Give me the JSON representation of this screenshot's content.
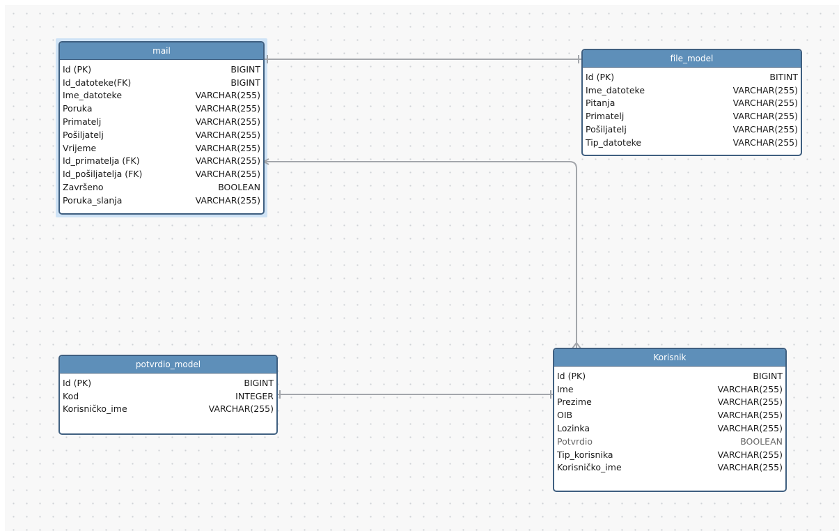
{
  "entities": {
    "mail": {
      "title": "mail",
      "fields": [
        {
          "name": "Id (PK)",
          "type": "BIGINT"
        },
        {
          "name": "Id_datoteke(FK)",
          "type": "BIGINT"
        },
        {
          "name": "Ime_datoteke",
          "type": "VARCHAR(255)"
        },
        {
          "name": "Poruka",
          "type": "VARCHAR(255)"
        },
        {
          "name": "Primatelj",
          "type": "VARCHAR(255)"
        },
        {
          "name": "Pošiljatelj",
          "type": "VARCHAR(255)"
        },
        {
          "name": "Vrijeme",
          "type": "VARCHAR(255)"
        },
        {
          "name": "Id_primatelja (FK)",
          "type": "VARCHAR(255)"
        },
        {
          "name": "Id_pošiljatelja (FK)",
          "type": "VARCHAR(255)"
        },
        {
          "name": "Završeno",
          "type": "BOOLEAN"
        },
        {
          "name": "Poruka_slanja",
          "type": "VARCHAR(255)"
        }
      ]
    },
    "file_model": {
      "title": "file_model",
      "fields": [
        {
          "name": "Id (PK)",
          "type": "BITINT"
        },
        {
          "name": "Ime_datoteke",
          "type": "VARCHAR(255)"
        },
        {
          "name": "Pitanja",
          "type": "VARCHAR(255)"
        },
        {
          "name": "Primatelj",
          "type": "VARCHAR(255)"
        },
        {
          "name": "Pošiljatelj",
          "type": "VARCHAR(255)"
        },
        {
          "name": "Tip_datoteke",
          "type": "VARCHAR(255)"
        }
      ]
    },
    "potvrdio_model": {
      "title": "potvrdio_model",
      "fields": [
        {
          "name": "Id (PK)",
          "type": "BIGINT"
        },
        {
          "name": "Kod",
          "type": "INTEGER"
        },
        {
          "name": "Korisničko_ime",
          "type": "VARCHAR(255)"
        }
      ]
    },
    "korisnik": {
      "title": "Korisnik",
      "fields": [
        {
          "name": "Id (PK)",
          "type": "BIGINT"
        },
        {
          "name": "Ime",
          "type": "VARCHAR(255)"
        },
        {
          "name": "Prezime",
          "type": "VARCHAR(255)"
        },
        {
          "name": "OIB",
          "type": "VARCHAR(255)"
        },
        {
          "name": "Lozinka",
          "type": "VARCHAR(255)"
        },
        {
          "name": "Potvrdio",
          "type": "BOOLEAN"
        },
        {
          "name": "Tip_korisnika",
          "type": "VARCHAR(255)"
        },
        {
          "name": "Korisničko_ime",
          "type": "VARCHAR(255)"
        }
      ]
    }
  },
  "colors": {
    "header": "#5e8fb9",
    "border": "#3f5f80",
    "connector": "#a3a6ab",
    "selection": "#cfe3f6"
  }
}
